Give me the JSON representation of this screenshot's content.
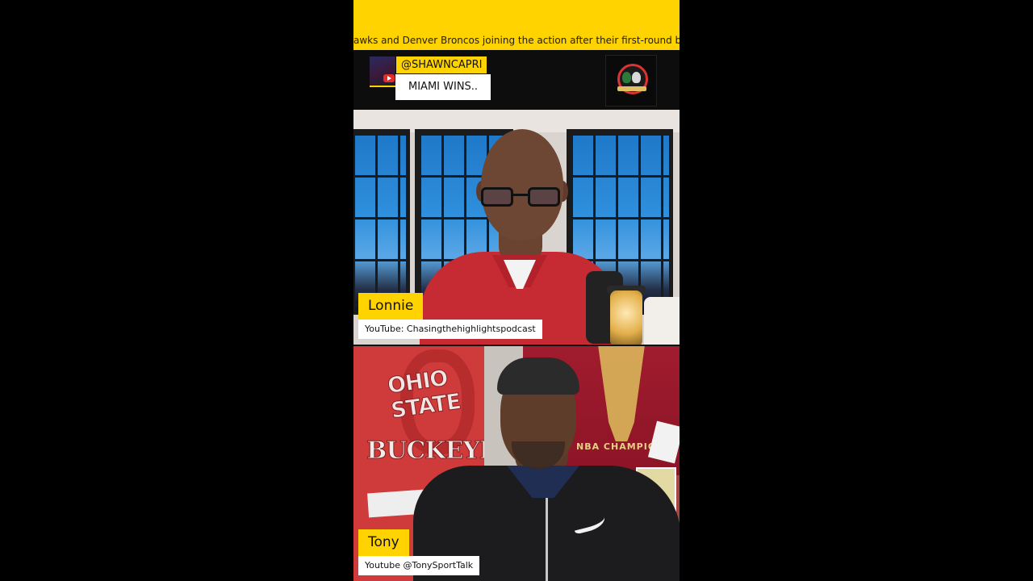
{
  "ticker": {
    "text": "awks and Denver Broncos joining the action after their first-round byes. The w"
  },
  "comment": {
    "username": "@SHAWNCAPRI",
    "message": "MIAMI WINS.."
  },
  "podcast_logo": {
    "icon": "podcast-logo-icon",
    "text": "PODCAST"
  },
  "hosts": [
    {
      "name": "Lonnie",
      "handle": "YouTube: Chasingthehighlightspodcast"
    },
    {
      "name": "Tony",
      "handle": "Youtube @TonySportTalk"
    }
  ],
  "background": {
    "ohio_text": "OHIO STATE",
    "buckeyes_text": "BUCKEYES",
    "champions_text": "NBA CHAMPION"
  },
  "colors": {
    "accent": "#fed300",
    "frame": "#000000"
  }
}
